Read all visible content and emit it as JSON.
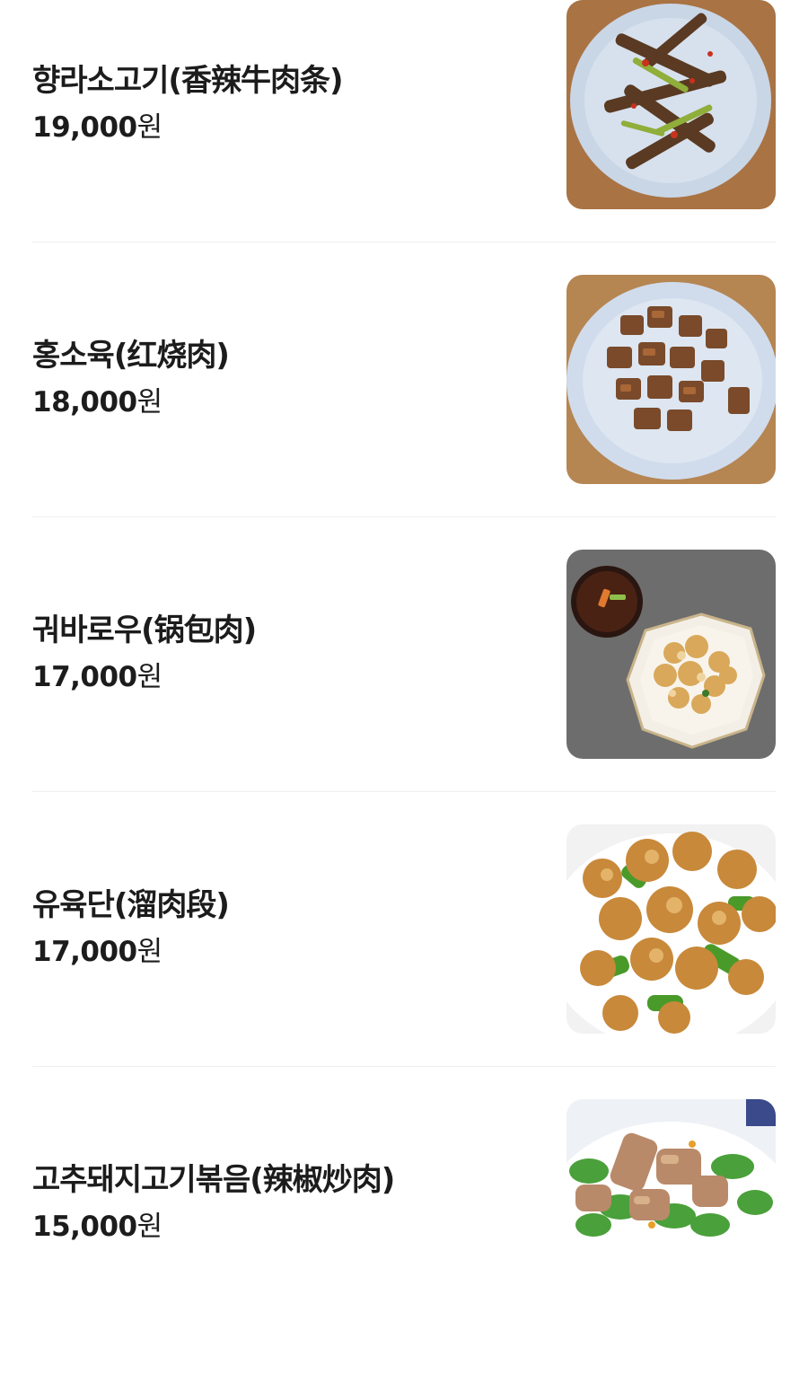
{
  "menu": {
    "items": [
      {
        "name": "향라소고기(香辣牛肉条)",
        "price": "19,000",
        "currency": "원",
        "photo": "food-photo-spicy-beef-strips",
        "bg": "#b07a4a",
        "plate": "#c9d6e6",
        "food": "#5a3a22",
        "accent": "#8fae3a"
      },
      {
        "name": "홍소육(红烧肉)",
        "price": "18,000",
        "currency": "원",
        "photo": "food-photo-braised-pork",
        "bg": "#b58552",
        "plate": "#d0dcec",
        "food": "#7a4a2a",
        "accent": "#b56f3a"
      },
      {
        "name": "궈바로우(锅包肉)",
        "price": "17,000",
        "currency": "원",
        "photo": "food-photo-guobaorou",
        "bg": "#6d6d6d",
        "plate": "#f3efe6",
        "food": "#d9a85a",
        "accent": "#3d1c12"
      },
      {
        "name": "유육단(溜肉段)",
        "price": "17,000",
        "currency": "원",
        "photo": "food-photo-liuroduan",
        "bg": "#f2f2f2",
        "plate": "#ffffff",
        "food": "#c8893a",
        "accent": "#4a9a2a"
      },
      {
        "name": "고추돼지고기볶음(辣椒炒肉)",
        "price": "15,000",
        "currency": "원",
        "photo": "food-photo-pepper-pork",
        "bg": "#eef1f6",
        "plate": "#ffffff",
        "food": "#b98a6a",
        "accent": "#4aa03a"
      }
    ]
  }
}
